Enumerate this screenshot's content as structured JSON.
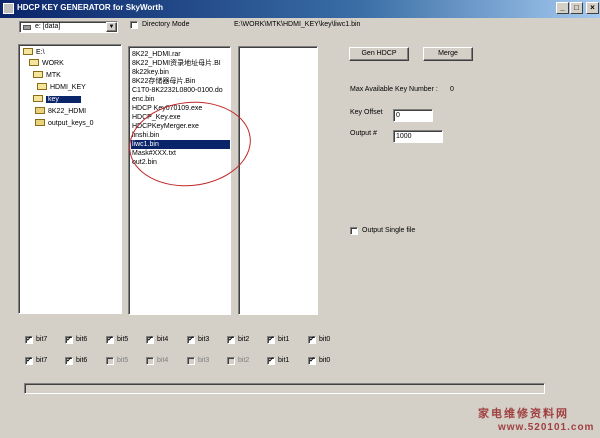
{
  "window": {
    "title": "HDCP KEY GENERATOR for SkyWorth",
    "buttons": [
      "_",
      "□",
      "×"
    ]
  },
  "drive_combo": {
    "value": "e: [data]"
  },
  "directory_mode": {
    "label": "Directory Mode",
    "checked": false
  },
  "current_path": "E:\\WORK\\MTK\\HDMI_KEY\\key\\liwc1.bin",
  "tree": [
    {
      "label": "E:\\",
      "indent": 0,
      "selected": false
    },
    {
      "label": "WORK",
      "indent": 1,
      "selected": false
    },
    {
      "label": "MTK",
      "indent": 2,
      "selected": false
    },
    {
      "label": "HDMI_KEY",
      "indent": 3,
      "selected": false
    },
    {
      "label": "key",
      "indent": 4,
      "selected": true
    },
    {
      "label": "8K22_HDMI",
      "indent": 5,
      "selected": false
    },
    {
      "label": "output_keys_0",
      "indent": 5,
      "selected": false
    }
  ],
  "files": [
    {
      "label": "8K22_HDMI.rar",
      "selected": false
    },
    {
      "label": "8K22_HDMI资录地址母片.BI",
      "selected": false
    },
    {
      "label": "8k22key.bin",
      "selected": false
    },
    {
      "label": "8K22存储器母片.Bin",
      "selected": false
    },
    {
      "label": "C1T0-8K2232L0800-0100.do",
      "selected": false
    },
    {
      "label": "enc.bin",
      "selected": false
    },
    {
      "label": "HDCP Key070109.exe",
      "selected": false
    },
    {
      "label": "HDCP_Key.exe",
      "selected": false
    },
    {
      "label": "HDCPKeyMerger.exe",
      "selected": false
    },
    {
      "label": "linshi.bin",
      "selected": false
    },
    {
      "label": "liwc1.bin",
      "selected": true
    },
    {
      "label": "Mask#XXX.txt",
      "selected": false
    },
    {
      "label": "out2.bin",
      "selected": false
    }
  ],
  "buttons": {
    "gen_hdcp": "Gen HDCP",
    "merge": "Merge"
  },
  "max_keys": {
    "label": "Max Available Key Number :",
    "value": "0"
  },
  "key_offset": {
    "label": "Key Offset",
    "value": "0"
  },
  "output_num": {
    "label": "Output  #",
    "value": "1000"
  },
  "output_single": {
    "label": "Output Single file",
    "checked": false
  },
  "bit_rows": [
    [
      {
        "label": "bit7",
        "checked": true,
        "enabled": true
      },
      {
        "label": "bit6",
        "checked": true,
        "enabled": true
      },
      {
        "label": "bit5",
        "checked": true,
        "enabled": true
      },
      {
        "label": "bit4",
        "checked": true,
        "enabled": true
      },
      {
        "label": "bit3",
        "checked": true,
        "enabled": true
      },
      {
        "label": "bit2",
        "checked": true,
        "enabled": true
      },
      {
        "label": "bit1",
        "checked": true,
        "enabled": true
      },
      {
        "label": "bit0",
        "checked": true,
        "enabled": true
      }
    ],
    [
      {
        "label": "bit7",
        "checked": true,
        "enabled": true
      },
      {
        "label": "bit6",
        "checked": true,
        "enabled": true
      },
      {
        "label": "bit5",
        "checked": false,
        "enabled": false
      },
      {
        "label": "bit4",
        "checked": false,
        "enabled": false
      },
      {
        "label": "bit3",
        "checked": false,
        "enabled": false
      },
      {
        "label": "bit2",
        "checked": false,
        "enabled": false
      },
      {
        "label": "bit1",
        "checked": true,
        "enabled": true
      },
      {
        "label": "bit0",
        "checked": true,
        "enabled": true
      }
    ]
  ],
  "progress": {
    "value": 0
  },
  "watermark": {
    "line1": "家电维修资料网",
    "line2": "www.520101.com"
  },
  "colors": {
    "titlebar": "#0a246a",
    "selection": "#0a246a",
    "annotation": "#c0282a",
    "watermark": "#a04040"
  }
}
